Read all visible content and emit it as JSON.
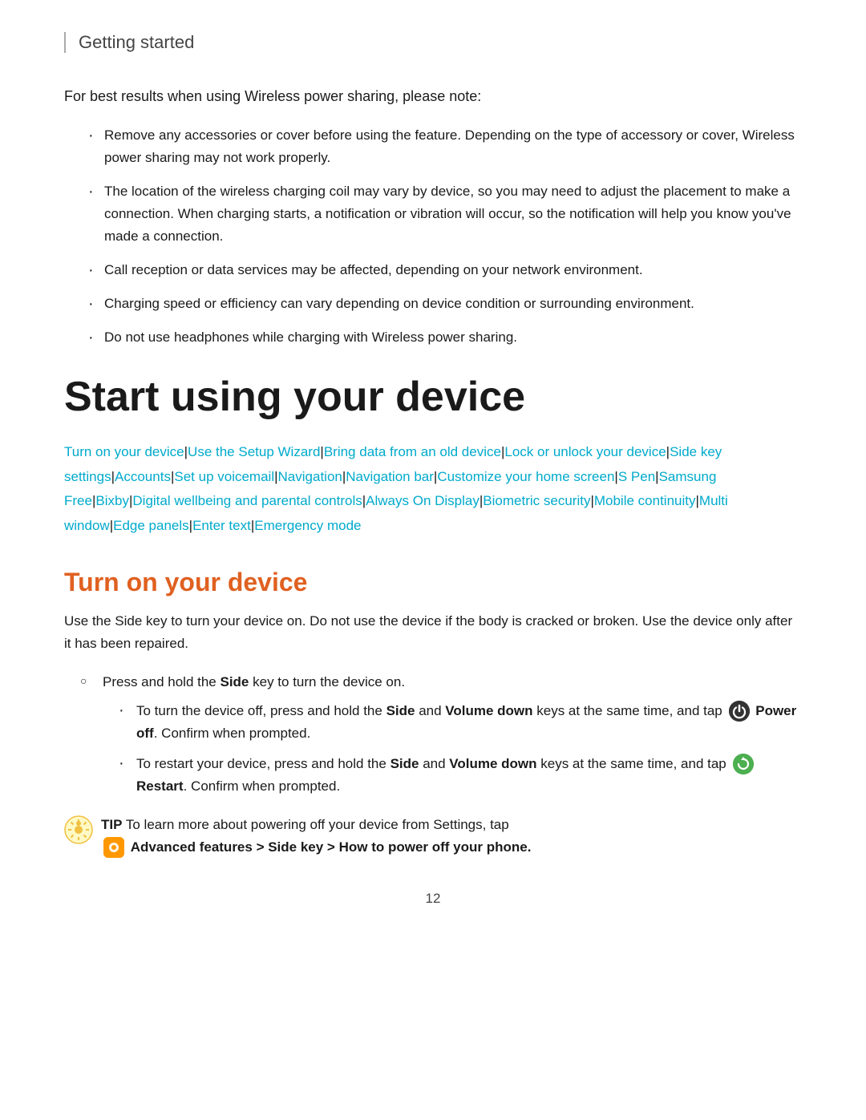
{
  "header": {
    "title": "Getting started"
  },
  "intro": {
    "text": "For best results when using Wireless power sharing, please note:"
  },
  "bullets": [
    "Remove any accessories or cover before using the feature. Depending on the type of accessory or cover, Wireless power sharing may not work properly.",
    "The location of the wireless charging coil may vary by device, so you may need to adjust the placement to make a connection. When charging starts, a notification or vibration will occur, so the notification will help you know you've made a connection.",
    "Call reception or data services may be affected, depending on your network environment.",
    "Charging speed or efficiency can vary depending on device condition or surrounding environment.",
    "Do not use headphones while charging with Wireless power sharing."
  ],
  "section": {
    "title": "Start using your device"
  },
  "toc": {
    "links": [
      "Turn on your device",
      "Use the Setup Wizard",
      "Bring data from an old device",
      "Lock or unlock your device",
      "Side key settings",
      "Accounts",
      "Set up voicemail",
      "Navigation",
      "Navigation bar",
      "Customize your home screen",
      "S Pen",
      "Samsung Free",
      "Bixby",
      "Digital wellbeing and parental controls",
      "Always On Display",
      "Biometric security",
      "Mobile continuity",
      "Multi window",
      "Edge panels",
      "Enter text",
      "Emergency mode"
    ]
  },
  "subsection": {
    "title": "Turn on your device",
    "body": "Use the Side key to turn your device on. Do not use the device if the body is cracked or broken. Use the device only after it has been repaired.",
    "circle_item": "Press and hold the Side key to turn the device on.",
    "sub_bullets": [
      {
        "text_before": "To turn the device off, press and hold the ",
        "bold1": "Side",
        "text_middle": " and ",
        "bold2": "Volume down",
        "text_after": " keys at the same time, and tap",
        "action": "Power off",
        "action_suffix": ". Confirm when prompted.",
        "icon_type": "power"
      },
      {
        "text_before": "To restart your device, press and hold the ",
        "bold1": "Side",
        "text_middle": " and ",
        "bold2": "Volume down",
        "text_after": " keys at the same time, and tap",
        "action": "Restart",
        "action_suffix": ". Confirm when prompted.",
        "icon_type": "restart"
      }
    ],
    "tip_label": "TIP",
    "tip_text": "To learn more about powering off your device from Settings, tap",
    "tip_bold": "Advanced features > Side key > How to power off your phone."
  },
  "page_number": "12"
}
